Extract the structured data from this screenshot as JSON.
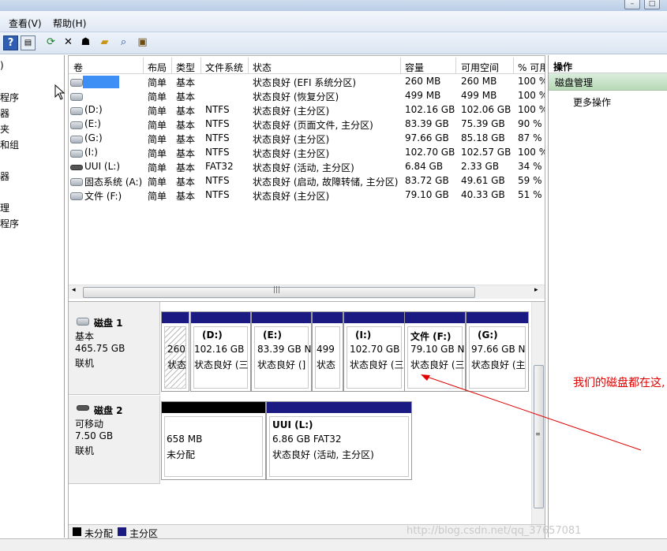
{
  "menu": {
    "view": "查看(V)",
    "help": "帮助(H)"
  },
  "left_nav": [
    ")",
    "程序",
    "器",
    "夹",
    "和组",
    "器",
    "",
    "程序"
  ],
  "volume_list": {
    "headers": [
      "卷",
      "布局",
      "类型",
      "文件系统",
      "状态",
      "容量",
      "可用空间",
      "% 可用"
    ],
    "rows": [
      {
        "name": "",
        "layout": "简单",
        "type": "基本",
        "fs": "",
        "status": "状态良好 (EFI 系统分区)",
        "capacity": "260 MB",
        "free": "260 MB",
        "pct": "100 %"
      },
      {
        "name": "",
        "layout": "简单",
        "type": "基本",
        "fs": "",
        "status": "状态良好 (恢复分区)",
        "capacity": "499 MB",
        "free": "499 MB",
        "pct": "100 %"
      },
      {
        "name": "(D:)",
        "layout": "简单",
        "type": "基本",
        "fs": "NTFS",
        "status": "状态良好 (主分区)",
        "capacity": "102.16 GB",
        "free": "102.06 GB",
        "pct": "100 %"
      },
      {
        "name": "(E:)",
        "layout": "简单",
        "type": "基本",
        "fs": "NTFS",
        "status": "状态良好 (页面文件, 主分区)",
        "capacity": "83.39 GB",
        "free": "75.39 GB",
        "pct": "90 %"
      },
      {
        "name": "(G:)",
        "layout": "简单",
        "type": "基本",
        "fs": "NTFS",
        "status": "状态良好 (主分区)",
        "capacity": "97.66 GB",
        "free": "85.18 GB",
        "pct": "87 %"
      },
      {
        "name": "(I:)",
        "layout": "简单",
        "type": "基本",
        "fs": "NTFS",
        "status": "状态良好 (主分区)",
        "capacity": "102.70 GB",
        "free": "102.57 GB",
        "pct": "100 %"
      },
      {
        "name": "UUI (L:)",
        "layout": "简单",
        "type": "基本",
        "fs": "FAT32",
        "status": "状态良好 (活动, 主分区)",
        "capacity": "6.84 GB",
        "free": "2.33 GB",
        "pct": "34 %"
      },
      {
        "name": "固态系统 (A:)",
        "layout": "简单",
        "type": "基本",
        "fs": "NTFS",
        "status": "状态良好 (启动, 故障转储, 主分区)",
        "capacity": "83.72 GB",
        "free": "49.61 GB",
        "pct": "59 %"
      },
      {
        "name": "文件 (F:)",
        "layout": "简单",
        "type": "基本",
        "fs": "NTFS",
        "status": "状态良好 (主分区)",
        "capacity": "79.10 GB",
        "free": "40.33 GB",
        "pct": "51 %"
      }
    ]
  },
  "disk1": {
    "label": {
      "name": "磁盘 1",
      "type": "基本",
      "size": "465.75 GB",
      "state": "联机"
    },
    "parts": [
      {
        "title": "",
        "size": "260",
        "status": "状态"
      },
      {
        "title": "(D:)",
        "size": "102.16 GB",
        "status": "状态良好 (三"
      },
      {
        "title": "(E:)",
        "size": "83.39 GB N",
        "status": "状态良好 (]"
      },
      {
        "title": "",
        "size": "499",
        "status": "状态"
      },
      {
        "title": "(I:)",
        "size": "102.70 GB",
        "status": "状态良好 (三"
      },
      {
        "title": "文件  (F:)",
        "size": "79.10 GB N",
        "status": "状态良好 (三"
      },
      {
        "title": "(G:)",
        "size": "97.66 GB N",
        "status": "状态良好 (主"
      }
    ]
  },
  "disk2": {
    "label": {
      "name": "磁盘 2",
      "type": "可移动",
      "size": "7.50 GB",
      "state": "联机"
    },
    "parts": [
      {
        "title": "",
        "size": "658 MB",
        "status": "未分配"
      },
      {
        "title": "UUI  (L:)",
        "size": "6.86 GB FAT32",
        "status": "状态良好 (活动, 主分区)"
      }
    ]
  },
  "legend": {
    "unallocated": "未分配",
    "primary": "主分区"
  },
  "actions": {
    "header": "操作",
    "selected": "磁盘管理",
    "more": "更多操作"
  },
  "annotation": "我们的磁盘都在这,",
  "watermark": "http://blog.csdn.net/qq_37657081",
  "colors": {
    "primary_partition": "#1a1a82",
    "unallocated": "#000000",
    "annotation": "#e00000",
    "action_selected": "#b7d9b6"
  },
  "icons": [
    "help-icon",
    "console-tree-icon",
    "refresh-icon",
    "delete-icon",
    "properties-icon",
    "open-icon",
    "search-icon",
    "export-icon"
  ]
}
